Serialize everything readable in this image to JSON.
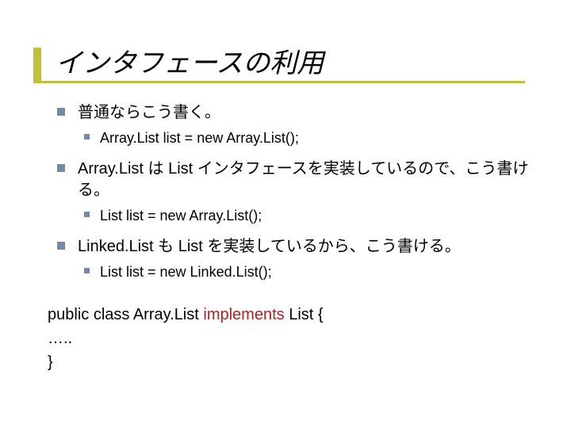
{
  "title": "インタフェースの利用",
  "bullets": {
    "b1": "普通ならこう書く。",
    "b1a": "Array.List list = new Array.List();",
    "b2": "Array.List は List インタフェースを実装しているので、こう書ける。",
    "b2a": "List list = new Array.List();",
    "b3": "Linked.List も List を実装しているから、こう書ける。",
    "b3a": "List list = new Linked.List();"
  },
  "code": {
    "line1_pre": "public class Array.List ",
    "line1_kw": "implements",
    "line1_post": " List {",
    "line2": " …..",
    "line3": "}"
  }
}
